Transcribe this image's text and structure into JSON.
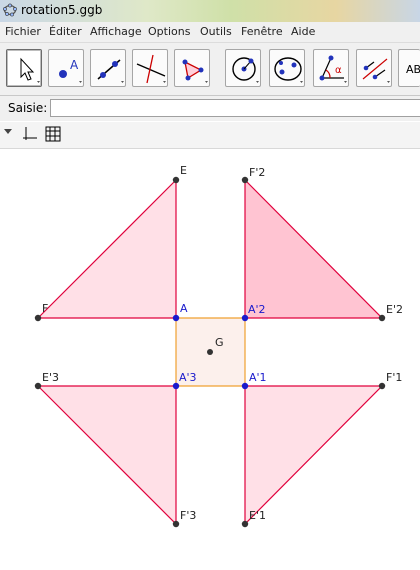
{
  "window": {
    "title": "rotation5.ggb"
  },
  "menu": [
    "Fichier",
    "Éditer",
    "Affichage",
    "Options",
    "Outils",
    "Fenêtre",
    "Aide"
  ],
  "toolbar": {
    "tools": [
      {
        "name": "move-tool-button"
      },
      {
        "name": "point-tool-button"
      },
      {
        "name": "line-tool-button"
      },
      {
        "name": "perpendicular-tool-button"
      },
      {
        "name": "polygon-tool-button"
      },
      {
        "name": "circle-tool-button"
      },
      {
        "name": "conic-tool-button"
      },
      {
        "name": "angle-tool-button"
      },
      {
        "name": "reflect-tool-button"
      }
    ],
    "text_tool_label": "ABC"
  },
  "input_bar": {
    "label": "Saisie:",
    "value": ""
  },
  "colors": {
    "polygon_stroke": "#e0003c",
    "polygon_fill": "#ffdce4",
    "polygon_fill_selected": "#ffc4d2",
    "square_stroke": "#f0a030",
    "square_fill": "#fcf0ec",
    "point_dark": "#333333",
    "point_blue": "#1a1acc"
  },
  "graphics": {
    "points": {
      "E": "E",
      "F": "F",
      "A": "A",
      "G": "G",
      "F2": "F'2",
      "E2": "E'2",
      "A2": "A'2",
      "E3": "E'3",
      "F3": "F'3",
      "A3": "A'3",
      "F1": "F'1",
      "E1": "E'1",
      "A1": "A'1"
    }
  }
}
